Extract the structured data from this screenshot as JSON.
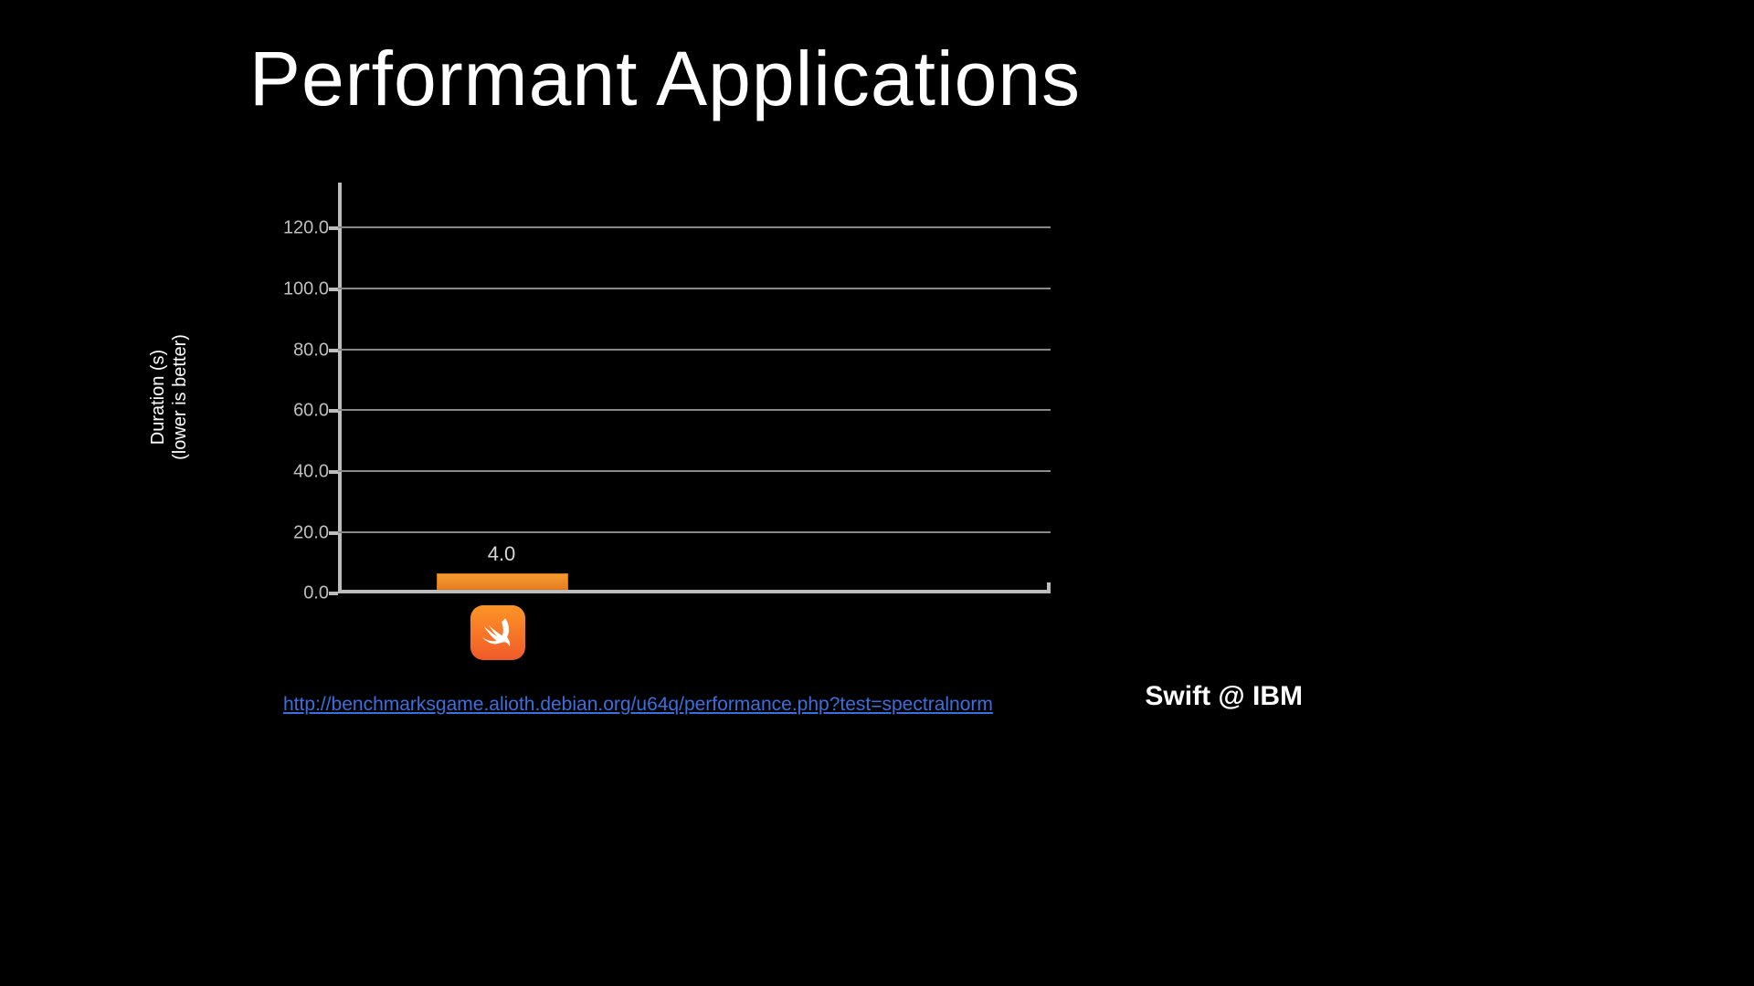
{
  "title": "Performant Applications",
  "ylabel_line1": "Duration (s)",
  "ylabel_line2": "(lower is better)",
  "link_text": "http://benchmarksgame.alioth.debian.org/u64q/performance.php?test=spectralnorm",
  "brand": "Swift @ IBM",
  "ticks": {
    "t0": "0.0",
    "t20": "20.0",
    "t40": "40.0",
    "t60": "60.0",
    "t80": "80.0",
    "t100": "100.0",
    "t120": "120.0"
  },
  "bar_label": "4.0",
  "category_icon": "swift-icon",
  "chart_data": {
    "type": "bar",
    "title": "Performant Applications",
    "ylabel": "Duration (s) (lower is better)",
    "ylim": [
      0,
      130
    ],
    "yticks": [
      0,
      20,
      40,
      60,
      80,
      100,
      120
    ],
    "categories": [
      "Swift"
    ],
    "values": [
      4.0
    ],
    "source": "http://benchmarksgame.alioth.debian.org/u64q/performance.php?test=spectralnorm",
    "note": "Swift @ IBM"
  }
}
